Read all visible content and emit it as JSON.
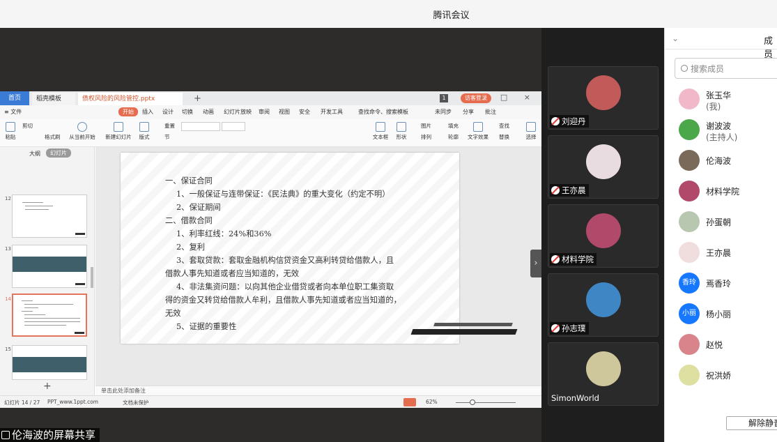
{
  "app": {
    "window_title": "腾讯会议"
  },
  "share": {
    "label": "伦海波的屏幕共享"
  },
  "wps": {
    "tabs": {
      "home": "首页",
      "templates": "稻壳模板",
      "file": "债权风险的风险管控.pptx",
      "plus": "+"
    },
    "badge": "1",
    "login": "访客登录",
    "window_buttons": "– □ ×",
    "menu": {
      "file": "≡ 文件",
      "start": "开始",
      "insert": "插入",
      "design": "设计",
      "switch": "切换",
      "animation": "动画",
      "slideshow": "幻灯片放映",
      "review": "审阅",
      "view": "视图",
      "security": "安全",
      "dev": "开发工具",
      "search": "查找命令、搜索模板",
      "sync": "未同步",
      "share": "分享",
      "comment": "批注"
    },
    "ribbon": {
      "paste": "粘贴",
      "cut": "剪切",
      "format": "格式刷",
      "from_current": "从当前开始",
      "new_slide": "新建幻灯片",
      "layout": "版式",
      "reset": "重置",
      "section": "节",
      "textbox": "文本框",
      "shape": "形状",
      "picture": "图片",
      "arrange": "排列",
      "outline": "轮廓",
      "fill": "填充",
      "textfx": "文字效果",
      "find": "查找",
      "replace": "替换",
      "select": "选择"
    },
    "left_tabs": {
      "outline": "大纲",
      "slides": "幻灯片"
    },
    "thumbs": [
      "12",
      "13",
      "14",
      "15"
    ],
    "add_slide": "+",
    "slide_lines": [
      "一、保证合同",
      "1、一般保证与连带保证：《民法典》的重大变化（约定不明）",
      "2、保证期间",
      "二、借款合同",
      "1、利率红线：24%和36%",
      "2、复利",
      "3、套取贷款：套取金融机构信贷资金又高利转贷给借款人，且",
      "借款人事先知道或者应当知道的，无效",
      "4、非法集资问题：以向其他企业借贷或者向本单位职工集资取",
      "得的资金又转贷给借款人牟利，且借款人事先知道或者应当知道的，",
      "无效",
      "5、证据的重要性"
    ],
    "notes": "单击此处添加备注",
    "status": {
      "slide_count": "幻灯片 14 / 27",
      "theme": "PPT_www.1ppt.com",
      "doc_state": "文档未保护",
      "zoom": "62%"
    }
  },
  "videos": [
    {
      "name": "刘迎丹",
      "muted": true,
      "color": "#c25a5a"
    },
    {
      "name": "王亦晨",
      "muted": true,
      "color": "#e8dce0"
    },
    {
      "name": "材料学院",
      "muted": true,
      "color": "#b14a6a"
    },
    {
      "name": "孙志璞",
      "muted": true,
      "color": "#3f86c4"
    },
    {
      "name": "SimonWorld",
      "muted": false,
      "color": "#cfc79c"
    }
  ],
  "members_panel": {
    "title": "成员",
    "search_placeholder": "搜索成员",
    "members": [
      {
        "name": "张玉华",
        "sub": "(我)",
        "avatar": "#f0b8c8"
      },
      {
        "name": "谢波波",
        "sub": "(主持人)",
        "avatar": "#4aa84a"
      },
      {
        "name": "伦海波",
        "sub": "",
        "avatar": "#7a6a5a"
      },
      {
        "name": "材料学院",
        "sub": "",
        "avatar": "#b14a6a"
      },
      {
        "name": "孙蛋朝",
        "sub": "",
        "avatar": "#b8c8b0"
      },
      {
        "name": "王亦晨",
        "sub": "",
        "avatar": "#f0dede"
      },
      {
        "name": "焉香玲",
        "sub": "",
        "avatar_text": "香玲"
      },
      {
        "name": "杨小丽",
        "sub": "",
        "avatar_text": "小丽"
      },
      {
        "name": "赵悦",
        "sub": "",
        "avatar": "#d8848a"
      },
      {
        "name": "祝洪娇",
        "sub": "",
        "avatar": "#dde0a0"
      }
    ],
    "unmute_button": "解除静音"
  }
}
